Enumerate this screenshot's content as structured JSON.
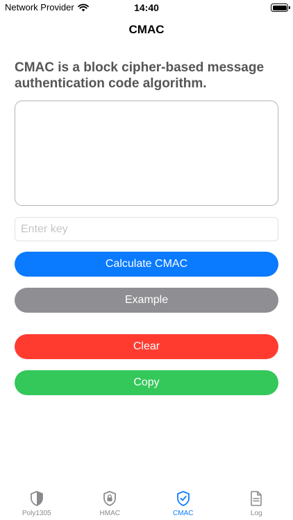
{
  "status_bar": {
    "carrier": "Network Provider",
    "time": "14:40"
  },
  "nav": {
    "title": "CMAC"
  },
  "main": {
    "description": "CMAC is a block cipher-based message authentication code algorithm.",
    "message_value": "",
    "key_placeholder": "Enter key",
    "calculate_label": "Calculate CMAC",
    "example_label": "Example",
    "clear_label": "Clear",
    "copy_label": "Copy"
  },
  "colors": {
    "accent": "#0a7aff",
    "example": "#8e8e93",
    "clear": "#ff3b30",
    "copy": "#34c759",
    "inactive_tab": "#8a8a8e"
  },
  "tab_bar": {
    "selected": "CMAC",
    "tabs": [
      {
        "label": "Poly1305",
        "icon": "shield-icon"
      },
      {
        "label": "HMAC",
        "icon": "shield-lock-icon"
      },
      {
        "label": "CMAC",
        "icon": "shield-check-icon"
      },
      {
        "label": "Log",
        "icon": "document-icon"
      }
    ]
  }
}
